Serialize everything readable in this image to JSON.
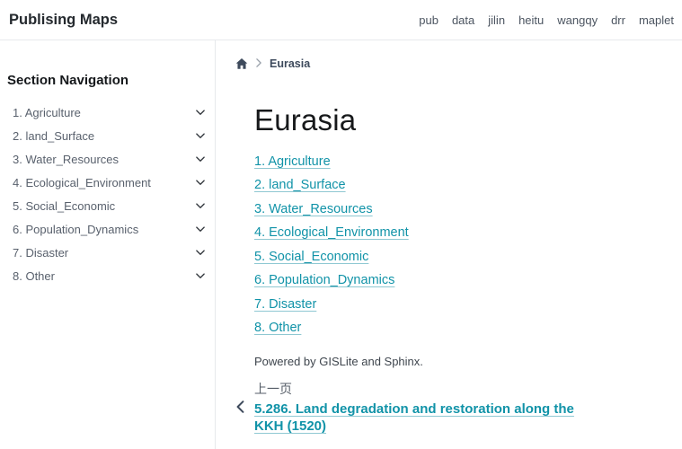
{
  "header": {
    "title": "Publising Maps",
    "nav": [
      "pub",
      "data",
      "jilin",
      "heitu",
      "wangqy",
      "drr",
      "maplet"
    ]
  },
  "sidebar": {
    "heading": "Section Navigation",
    "items": [
      "1. Agriculture",
      "2. land_Surface",
      "3. Water_Resources",
      "4. Ecological_Environment",
      "5. Social_Economic",
      "6. Population_Dynamics",
      "7. Disaster",
      "8. Other"
    ]
  },
  "breadcrumb": {
    "current": "Eurasia"
  },
  "main": {
    "title": "Eurasia",
    "links": [
      "1. Agriculture",
      "2. land_Surface",
      "3. Water_Resources",
      "4. Ecological_Environment",
      "5. Social_Economic",
      "6. Population_Dynamics",
      "7. Disaster",
      "8. Other"
    ],
    "powered_by": "Powered by GISLite and Sphinx.",
    "prev_label": "上一页",
    "prev_link": "5.286. Land degradation and restoration along the KKH (1520)"
  },
  "icons": {
    "home": "home-icon",
    "breadcrumb_separator": "chevron-right-icon",
    "sidebar_expand": "chevron-down-icon",
    "prev_page": "chevron-left-icon"
  },
  "colors": {
    "link": "#1193a8",
    "link_underline": "#8fc8d2",
    "breadcrumb_text": "#3d4a5c",
    "border": "#e7e9ec",
    "sidebar_text": "#59616d",
    "header_nav_text": "#4c5561"
  }
}
